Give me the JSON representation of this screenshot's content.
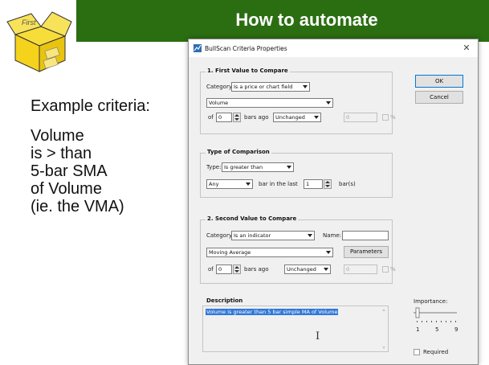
{
  "slide": {
    "title": "How to automate",
    "logo_text": "First",
    "criteria_title": "Example criteria:",
    "criteria_lines": [
      "Volume",
      "is > than",
      "5-bar SMA",
      "of Volume",
      "(ie. the VMA)"
    ],
    "colors": {
      "header_green": "#2b6e12",
      "logo_yellow": "#f5d31c"
    }
  },
  "dialog": {
    "title": "BullScan Criteria Properties",
    "close_icon": "close-icon",
    "ok_label": "OK",
    "cancel_label": "Cancel",
    "first_value": {
      "group_title": "1. First Value to Compare",
      "category_label": "Category:",
      "category_value": "Is a price or chart field",
      "field_value": "Volume",
      "of_label": "of",
      "of_value": "0",
      "bars_ago_label": "bars ago",
      "change_value": "Unchanged",
      "pct_value": "0",
      "pct_suffix": "%"
    },
    "comparison": {
      "group_title": "Type of Comparison",
      "type_label": "Type:",
      "type_value": "Is greater than",
      "any_value": "Any",
      "bar_in_last_label": "bar in the last",
      "bars_value": "1",
      "bars_suffix": "bar(s)"
    },
    "second_value": {
      "group_title": "2. Second Value to Compare",
      "category_label": "Category:",
      "category_value": "Is an indicator",
      "name_label": "Name:",
      "name_value": "",
      "indicator_value": "Moving Average",
      "parameters_label": "Parameters",
      "of_label": "of",
      "of_value": "0",
      "bars_ago_label": "bars ago",
      "change_value": "Unchanged",
      "pct_value": "0",
      "pct_suffix": "%"
    },
    "description": {
      "group_title": "Description",
      "text": "Volume is greater than 5 bar simple MA of Volume"
    },
    "importance": {
      "label": "Importance:",
      "ticks": [
        "1",
        "5",
        "9"
      ],
      "value": 1
    },
    "required_label": "Required"
  }
}
